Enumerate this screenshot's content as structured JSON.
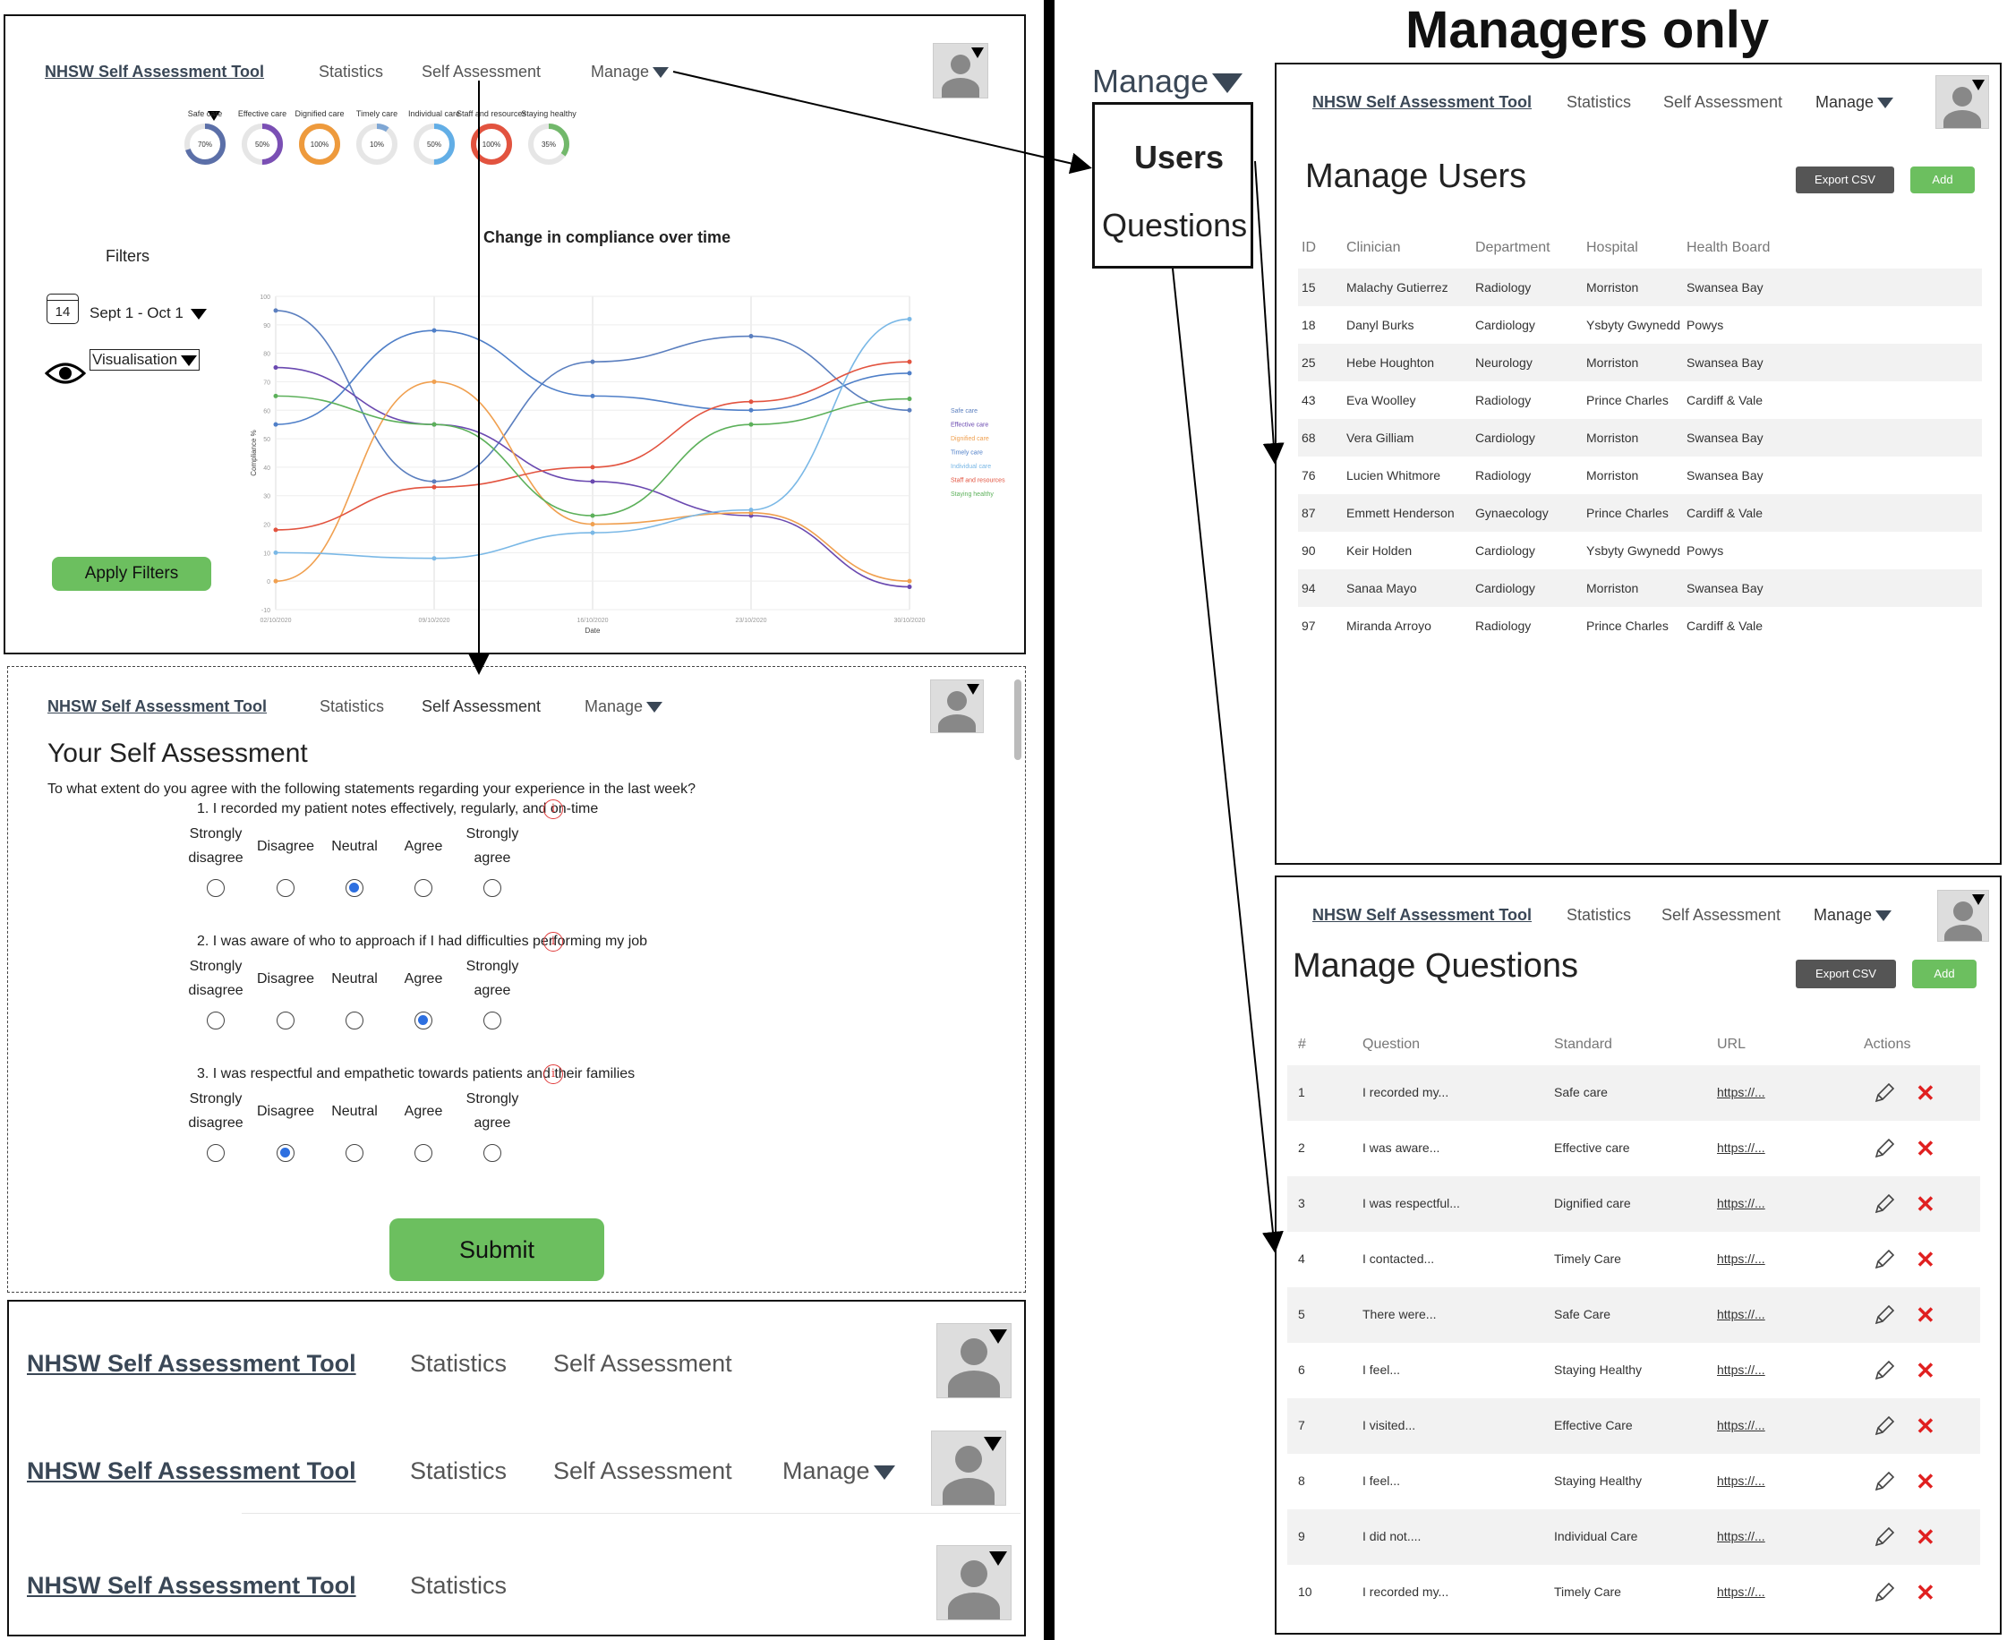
{
  "header_label": "Managers only",
  "app": {
    "brand": "NHSW Self Assessment Tool",
    "nav_statistics": "Statistics",
    "nav_self_assessment": "Self Assessment",
    "nav_manage": "Manage"
  },
  "stats_page": {
    "gauges": [
      {
        "label": "Safe care",
        "value": "70%",
        "pct": 70,
        "color": "#5b6fa8"
      },
      {
        "label": "Effective care",
        "value": "50%",
        "pct": 50,
        "color": "#7a4fb4"
      },
      {
        "label": "Dignified care",
        "value": "100%",
        "pct": 100,
        "color": "#ee9a3c"
      },
      {
        "label": "Timely care",
        "value": "10%",
        "pct": 10,
        "color": "#7ea6d4"
      },
      {
        "label": "Individual care",
        "value": "50%",
        "pct": 50,
        "color": "#62aee6"
      },
      {
        "label": "Staff and resources",
        "value": "100%",
        "pct": 100,
        "color": "#e2533f"
      },
      {
        "label": "Staying healthy",
        "value": "35%",
        "pct": 35,
        "color": "#72b86b"
      }
    ],
    "filters_title": "Filters",
    "date_day": "14",
    "date_range": "Sept 1 - Oct 1",
    "visualisation": "Visualisation",
    "apply_filters": "Apply Filters",
    "chart_title": "Change in compliance over time"
  },
  "chart_data": {
    "type": "line",
    "title": "Change in compliance over time",
    "xlabel": "Date",
    "ylabel": "Compliance %",
    "categories": [
      "02/10/2020",
      "09/10/2020",
      "16/10/2020",
      "23/10/2020",
      "30/10/2020"
    ],
    "ylim": [
      -10,
      100
    ],
    "grid": true,
    "legend_position": "right",
    "series": [
      {
        "name": "Safe care",
        "color": "#5b7fbf",
        "values": [
          95,
          35,
          77,
          86,
          60
        ]
      },
      {
        "name": "Effective care",
        "color": "#6a49b0",
        "values": [
          75,
          55,
          35,
          23,
          -2
        ]
      },
      {
        "name": "Dignified care",
        "color": "#f0a050",
        "values": [
          0,
          70,
          20,
          24,
          0
        ]
      },
      {
        "name": "Timely care",
        "color": "#4f7fc8",
        "values": [
          55,
          88,
          65,
          60,
          73
        ]
      },
      {
        "name": "Individual care",
        "color": "#7ab8e6",
        "values": [
          10,
          8,
          17,
          25,
          92
        ]
      },
      {
        "name": "Staff and resources",
        "color": "#e2533f",
        "values": [
          18,
          33,
          40,
          63,
          77
        ]
      },
      {
        "name": "Staying healthy",
        "color": "#5cb05a",
        "values": [
          65,
          55,
          23,
          55,
          64
        ]
      }
    ]
  },
  "assessment": {
    "title": "Your Self Assessment",
    "intro": "To what extent do you agree with the following statements regarding your experience in the last week?",
    "options": [
      "Strongly disagree",
      "Disagree",
      "Neutral",
      "Agree",
      "Strongly agree"
    ],
    "questions": [
      {
        "text": "1. I recorded my patient notes effectively, regularly, and on-time",
        "selected": 2
      },
      {
        "text": "2. I was aware of who to approach if I had difficulties performing my job",
        "selected": 3
      },
      {
        "text": "3. I was respectful and empathetic towards patients and their families",
        "selected": 1
      }
    ],
    "submit": "Submit"
  },
  "manage_menu": {
    "title": "Manage",
    "users": "Users",
    "questions": "Questions"
  },
  "manage_users": {
    "title": "Manage Users",
    "export": "Export CSV",
    "add": "Add",
    "columns": [
      "ID",
      "Clinician",
      "Department",
      "Hospital",
      "Health Board"
    ],
    "rows": [
      [
        "15",
        "Malachy Gutierrez",
        "Radiology",
        "Morriston",
        "Swansea Bay"
      ],
      [
        "18",
        "Danyl Burks",
        "Cardiology",
        "Ysbyty Gwynedd",
        "Powys"
      ],
      [
        "25",
        "Hebe Houghton",
        "Neurology",
        "Morriston",
        "Swansea Bay"
      ],
      [
        "43",
        "Eva Woolley",
        "Radiology",
        "Prince Charles",
        "Cardiff & Vale"
      ],
      [
        "68",
        "Vera Gilliam",
        "Cardiology",
        "Morriston",
        "Swansea Bay"
      ],
      [
        "76",
        "Lucien Whitmore",
        "Radiology",
        "Morriston",
        "Swansea Bay"
      ],
      [
        "87",
        "Emmett Henderson",
        "Gynaecology",
        "Prince Charles",
        "Cardiff & Vale"
      ],
      [
        "90",
        "Keir Holden",
        "Cardiology",
        "Ysbyty Gwynedd",
        "Powys"
      ],
      [
        "94",
        "Sanaa Mayo",
        "Cardiology",
        "Morriston",
        "Swansea Bay"
      ],
      [
        "97",
        "Miranda Arroyo",
        "Radiology",
        "Prince Charles",
        "Cardiff & Vale"
      ]
    ]
  },
  "manage_questions": {
    "title": "Manage Questions",
    "export": "Export CSV",
    "add": "Add",
    "columns": [
      "#",
      "Question",
      "Standard",
      "URL",
      "Actions"
    ],
    "rows": [
      [
        "1",
        "I recorded my...",
        "Safe care",
        "https://..."
      ],
      [
        "2",
        "I was aware...",
        "Effective care",
        "https://..."
      ],
      [
        "3",
        "I was respectful...",
        "Dignified care",
        "https://..."
      ],
      [
        "4",
        "I contacted...",
        "Timely Care",
        "https://..."
      ],
      [
        "5",
        "There were...",
        "Safe Care",
        "https://..."
      ],
      [
        "6",
        "I feel...",
        "Staying Healthy",
        "https://..."
      ],
      [
        "7",
        "I visited...",
        "Effective Care",
        "https://..."
      ],
      [
        "8",
        "I feel...",
        "Staying Healthy",
        "https://..."
      ],
      [
        "9",
        "I did not....",
        "Individual Care",
        "https://..."
      ],
      [
        "10",
        "I recorded my...",
        "Timely Care",
        "https://..."
      ]
    ]
  }
}
